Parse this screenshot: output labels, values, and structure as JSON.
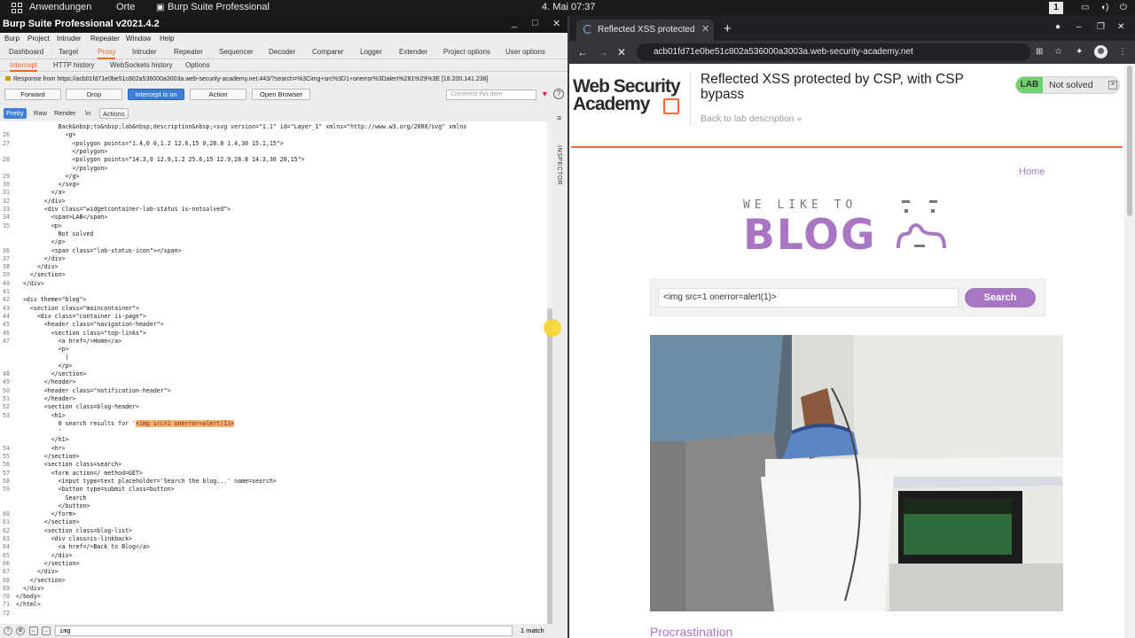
{
  "os_bar": {
    "apps_label": "Anwendungen",
    "places_label": "Orte",
    "active_app": "Burp Suite Professional",
    "clock": "4. Mai  07:37",
    "workspace": "1"
  },
  "burp": {
    "title": "Burp Suite Professional v2021.4.2",
    "window_controls": [
      "_",
      "□",
      "✕"
    ],
    "menu": [
      "Burp",
      "Project",
      "Intruder",
      "Repeater",
      "Window",
      "Help"
    ],
    "main_tabs": [
      "Dashboard",
      "Target",
      "Proxy",
      "Intruder",
      "Repeater",
      "Sequencer",
      "Decoder",
      "Comparer",
      "Logger",
      "Extender",
      "Project options",
      "User options"
    ],
    "active_main_tab": "Proxy",
    "sub_tabs": [
      "Intercept",
      "HTTP history",
      "WebSockets history",
      "Options"
    ],
    "active_sub_tab": "Intercept",
    "response_info": "Response from https://acb01fd71e0be51c802a536000a3003a.web-security-academy.net:443/?search=%3Cimg+src%3D1+onerror%3Dalert%281%29%3E  [18.200.141.238]",
    "buttons": {
      "forward": "Forward",
      "drop": "Drop",
      "intercept": "Intercept is on",
      "action": "Action",
      "open_browser": "Open Browser"
    },
    "comment_placeholder": "Comment this item",
    "view_tabs": [
      "Pretty",
      "Raw",
      "Render",
      "\\n"
    ],
    "active_view_tab": "Pretty",
    "actions_label": "Actions",
    "inspector_label": "INSPECTOR",
    "code_lines": [
      {
        "n": "",
        "t": "            Back&nbsp;to&nbsp;lab&nbsp;description&nbsp;<svg version=\"1.1\" id=\"Layer_1\" xmlns=\"http://www.w3.org/2000/svg\" xmlns"
      },
      {
        "n": "26",
        "t": "              <g>"
      },
      {
        "n": "27",
        "t": "                <polygon points=\"1.4,0 0,1.2 12.6,15 0,28.8 1.4,30 15.1,15\">"
      },
      {
        "n": "",
        "t": "                </polygon>"
      },
      {
        "n": "28",
        "t": "                <polygon points=\"14.3,0 12.9,1.2 25.6,15 12.9,28.8 14.3,30 28,15\">"
      },
      {
        "n": "",
        "t": "                </polygon>"
      },
      {
        "n": "29",
        "t": "              </g>"
      },
      {
        "n": "30",
        "t": "            </svg>"
      },
      {
        "n": "31",
        "t": "          </a>"
      },
      {
        "n": "32",
        "t": "        </div>"
      },
      {
        "n": "33",
        "t": "        <div class=\"widgetcontainer-lab-status is-notsolved\">"
      },
      {
        "n": "34",
        "t": "          <span>LAB</span>"
      },
      {
        "n": "35",
        "t": "          <p>"
      },
      {
        "n": "",
        "t": "            Not solved"
      },
      {
        "n": "",
        "t": "          </p>"
      },
      {
        "n": "36",
        "t": "          <span class=\"lab-status-icon\"></span>"
      },
      {
        "n": "37",
        "t": "        </div>"
      },
      {
        "n": "38",
        "t": "      </div>"
      },
      {
        "n": "39",
        "t": "    </section>"
      },
      {
        "n": "40",
        "t": "  </div>"
      },
      {
        "n": "41",
        "t": ""
      },
      {
        "n": "42",
        "t": "  <div theme=\"blog\">"
      },
      {
        "n": "43",
        "t": "    <section class=\"maincontainer\">"
      },
      {
        "n": "44",
        "t": "      <div class=\"container is-page\">"
      },
      {
        "n": "45",
        "t": "        <header class=\"navigation-header\">"
      },
      {
        "n": "46",
        "t": "          <section class=\"top-links\">"
      },
      {
        "n": "47",
        "t": "            <a href=/>Home</a>"
      },
      {
        "n": "",
        "t": "            <p>"
      },
      {
        "n": "",
        "t": "              |"
      },
      {
        "n": "",
        "t": "            </p>"
      },
      {
        "n": "48",
        "t": "          </section>"
      },
      {
        "n": "49",
        "t": "        </header>"
      },
      {
        "n": "50",
        "t": "        <header class=\"notification-header\">"
      },
      {
        "n": "51",
        "t": "        </header>"
      },
      {
        "n": "52",
        "t": "        <section class=blog-header>"
      },
      {
        "n": "53",
        "t": "          <h1>"
      },
      {
        "n": "",
        "t": "            0 search results for '",
        "hl": "<img src=1 onerror=alert(1)>"
      },
      {
        "n": "",
        "t": "            '"
      },
      {
        "n": "",
        "t": "          </h1>"
      },
      {
        "n": "54",
        "t": "          <hr>"
      },
      {
        "n": "55",
        "t": "        </section>"
      },
      {
        "n": "56",
        "t": "        <section class=search>"
      },
      {
        "n": "57",
        "t": "          <form action=/ method=GET>"
      },
      {
        "n": "58",
        "t": "            <input type=text placeholder='Search the blog...' name=search>"
      },
      {
        "n": "59",
        "t": "            <button type=submit class=button>"
      },
      {
        "n": "",
        "t": "              Search"
      },
      {
        "n": "",
        "t": "            </button>"
      },
      {
        "n": "60",
        "t": "          </form>"
      },
      {
        "n": "61",
        "t": "        </section>"
      },
      {
        "n": "62",
        "t": "        <section class=blog-list>"
      },
      {
        "n": "63",
        "t": "          <div class=is-linkback>"
      },
      {
        "n": "64",
        "t": "            <a href=/>Back to Blog</a>"
      },
      {
        "n": "65",
        "t": "          </div>"
      },
      {
        "n": "66",
        "t": "        </section>"
      },
      {
        "n": "67",
        "t": "      </div>"
      },
      {
        "n": "68",
        "t": "    </section>"
      },
      {
        "n": "69",
        "t": "  </div>"
      },
      {
        "n": "70",
        "t": "</body>"
      },
      {
        "n": "71",
        "t": "</html>"
      },
      {
        "n": "72",
        "t": ""
      }
    ],
    "find_value": "img",
    "find_count": "1 match"
  },
  "browser": {
    "tab_title": "Reflected XSS protected b",
    "new_tab": "+",
    "url": "acb01fd71e0be51c802a536000a3003a.web-security-academy.net",
    "page": {
      "logo_line1": "Web Security",
      "logo_line2": "Academy",
      "lab_title": "Reflected XSS protected by CSP, with CSP bypass",
      "back_link": "Back to lab description",
      "lab_badge": "LAB",
      "lab_status": "Not solved",
      "home_link": "Home",
      "blog_tag": "WE LIKE TO",
      "blog_word": "BLOG",
      "search_value": "<img src=1 onerror=alert(1)>",
      "search_button": "Search",
      "post_title": "Procrastination"
    }
  }
}
